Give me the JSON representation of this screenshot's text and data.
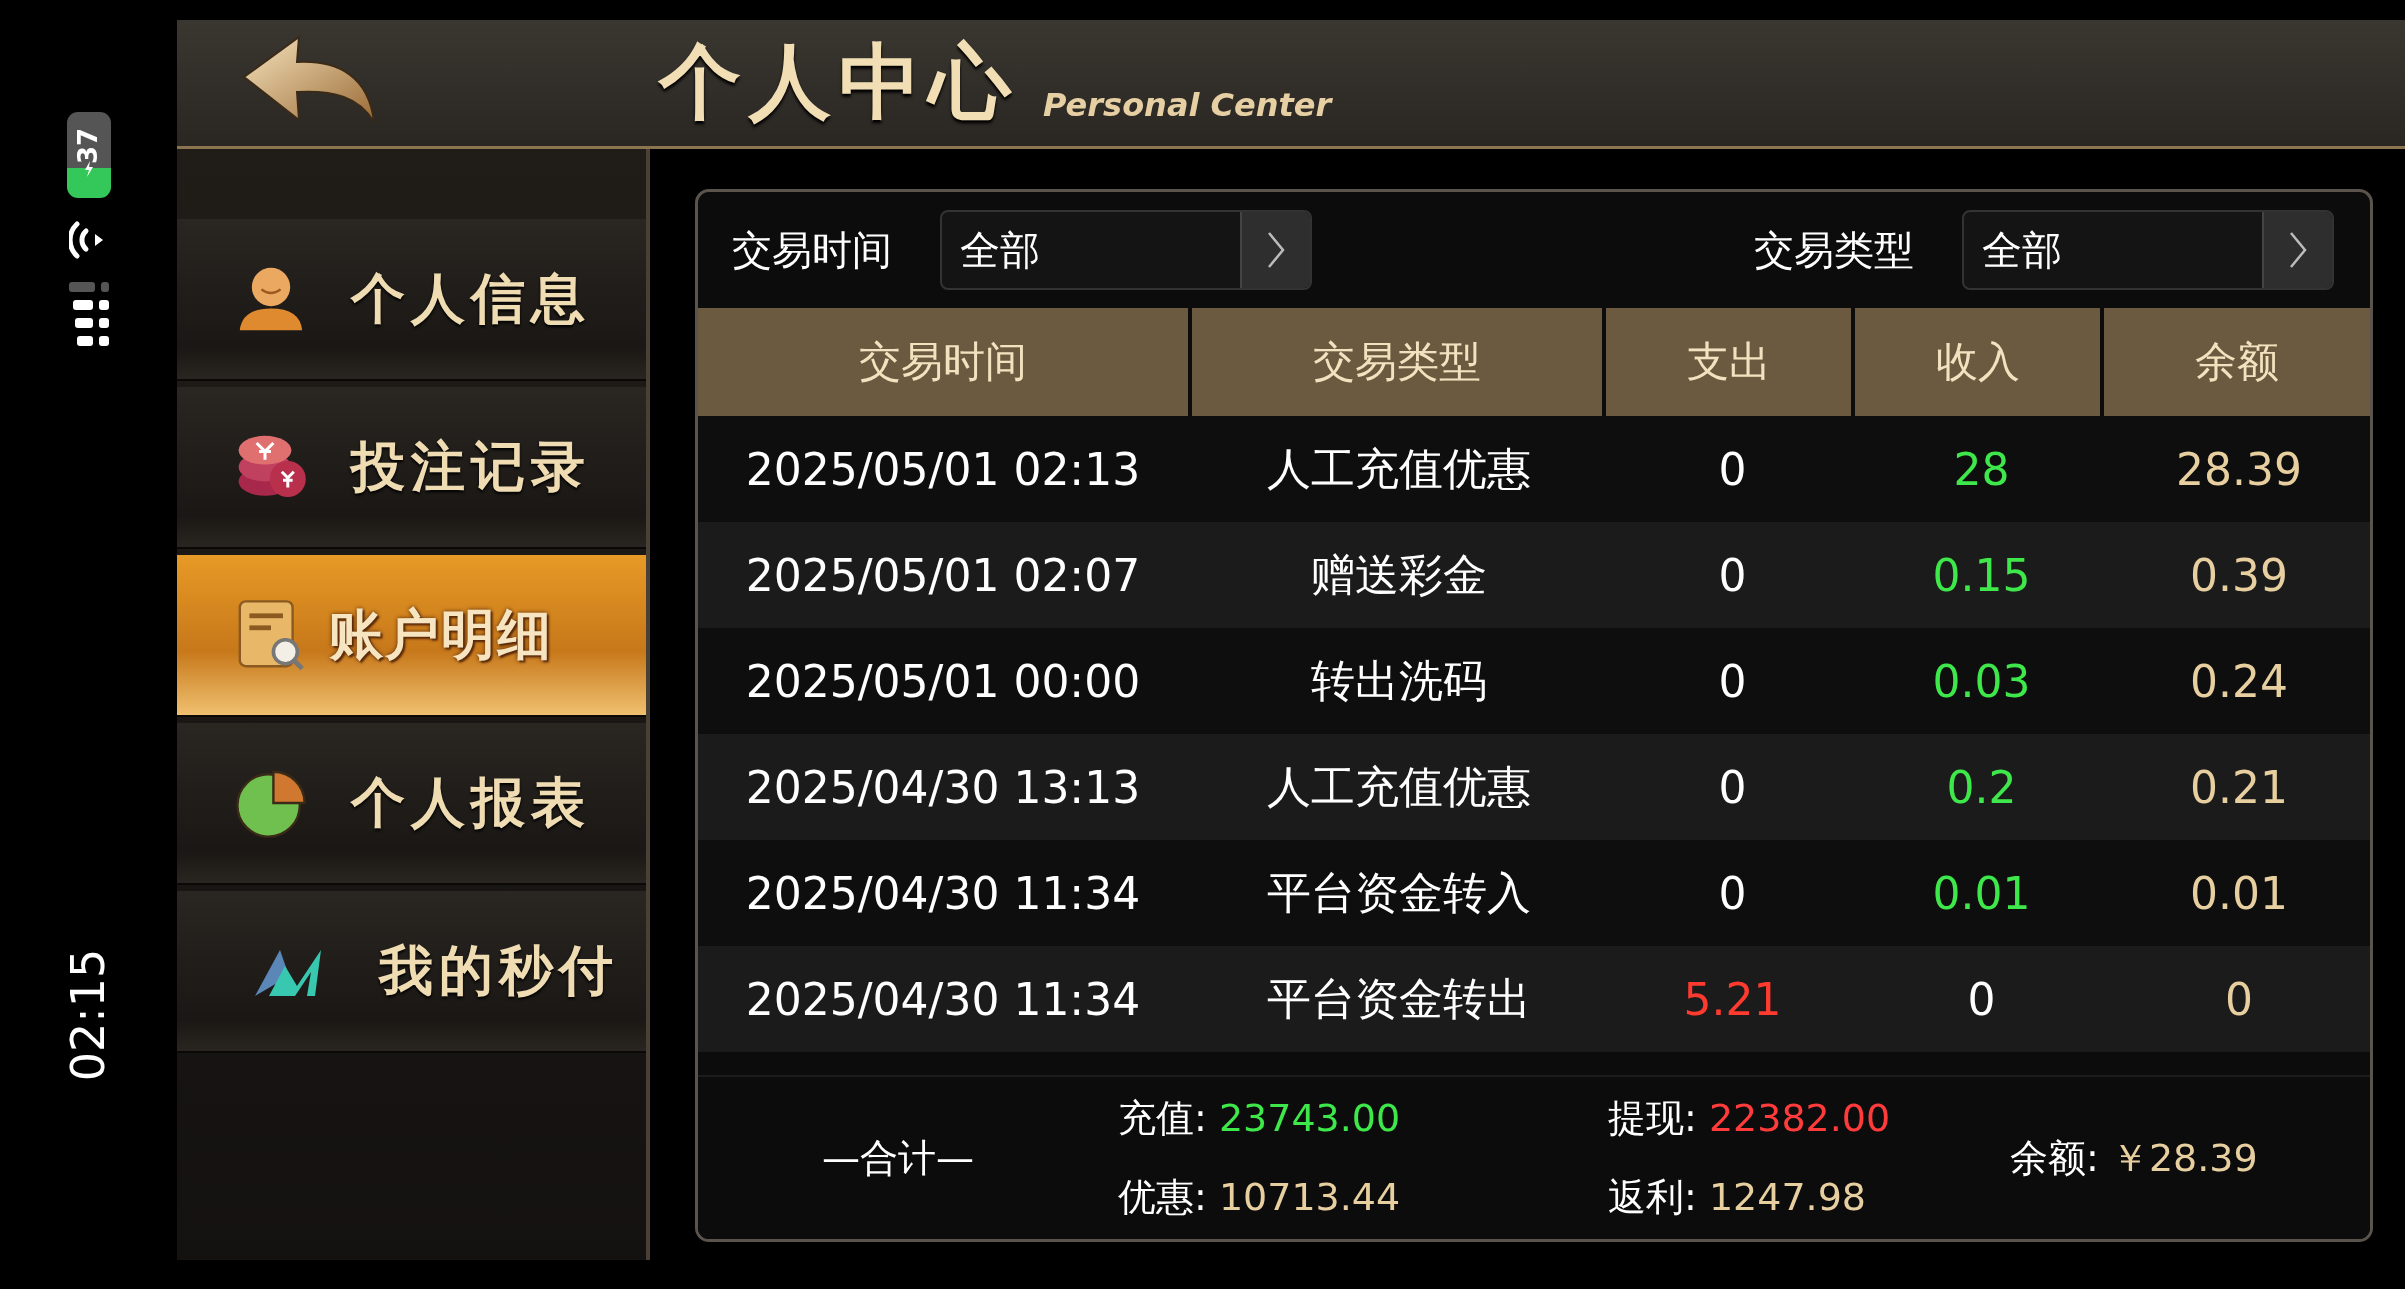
{
  "status_bar": {
    "battery": "37",
    "time": "02:15"
  },
  "header": {
    "title": "个人中心",
    "subtitle": "Personal Center"
  },
  "sidebar": {
    "items": [
      {
        "label": "个人信息",
        "kind": "person",
        "selected": false
      },
      {
        "label": "投注记录",
        "kind": "coins",
        "selected": false
      },
      {
        "label": "账户明细",
        "kind": "ledger",
        "selected": true
      },
      {
        "label": "个人报表",
        "kind": "pie",
        "selected": false
      },
      {
        "label": "我的秒付",
        "kind": "mark",
        "selected": false
      }
    ]
  },
  "filters": [
    {
      "label": "交易时间",
      "value": "全部"
    },
    {
      "label": "交易类型",
      "value": "全部"
    }
  ],
  "table": {
    "columns": [
      "交易时间",
      "交易类型",
      "支出",
      "收入",
      "余额"
    ],
    "rows": [
      {
        "kind": "credit",
        "time": "2025/05/01 02:13",
        "type": "人工充值优惠",
        "expense": "0",
        "income": "28",
        "balance": "28.39"
      },
      {
        "kind": "credit",
        "time": "2025/05/01 02:07",
        "type": "赠送彩金",
        "expense": "0",
        "income": "0.15",
        "balance": "0.39"
      },
      {
        "kind": "credit",
        "time": "2025/05/01 00:00",
        "type": "转出洗码",
        "expense": "0",
        "income": "0.03",
        "balance": "0.24"
      },
      {
        "kind": "credit",
        "time": "2025/04/30 13:13",
        "type": "人工充值优惠",
        "expense": "0",
        "income": "0.2",
        "balance": "0.21"
      },
      {
        "kind": "credit",
        "time": "2025/04/30 11:34",
        "type": "平台资金转入",
        "expense": "0",
        "income": "0.01",
        "balance": "0.01"
      },
      {
        "kind": "debit",
        "time": "2025/04/30 11:34",
        "type": "平台资金转出",
        "expense": "5.21",
        "income": "0",
        "balance": "0"
      }
    ]
  },
  "totals": {
    "label": "—合计—",
    "items": [
      {
        "label": "充值:",
        "value": "23743.00",
        "color": "#3ee84a"
      },
      {
        "label": "提现:",
        "value": "22382.00",
        "color": "#ff3b3b"
      },
      {
        "label": "优惠:",
        "value": "10713.44",
        "color": "#e8cfa0"
      },
      {
        "label": "返利:",
        "value": "1247.98",
        "color": "#e8cfa0"
      }
    ],
    "balance": {
      "label": "余额:",
      "value": "￥28.39"
    }
  }
}
